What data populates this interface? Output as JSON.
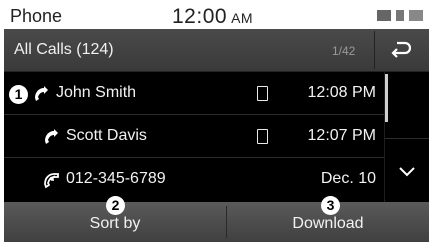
{
  "status_bar": {
    "app_title": "Phone",
    "time": "12:00",
    "ampm": "AM"
  },
  "header": {
    "title": "All Calls (124)",
    "page_indicator": "1/42"
  },
  "calls": [
    {
      "name": "John Smith",
      "time": "12:08 PM",
      "type": "outgoing",
      "device_icon": "mobile-phone-icon"
    },
    {
      "name": "Scott Davis",
      "time": "12:07 PM",
      "type": "outgoing",
      "device_icon": "mobile-phone-icon"
    },
    {
      "name": "012-345-6789",
      "time": "Dec. 10",
      "type": "incoming",
      "device_icon": ""
    }
  ],
  "markers": [
    "1",
    "2",
    "3"
  ],
  "buttons": {
    "sort_by": "Sort by",
    "download": "Download"
  },
  "colors": {
    "background": "#000000",
    "header": "#444444",
    "bottom_bar": "#4d4d4d",
    "text": "#f2f2f2"
  }
}
